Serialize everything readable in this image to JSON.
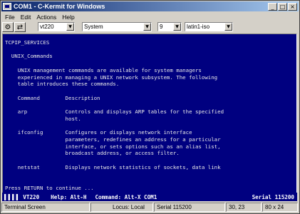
{
  "window": {
    "title": "COM1 - C-Kermit for Windows",
    "controls": {
      "minimize": "_",
      "maximize": "□",
      "close": "×"
    }
  },
  "menu": [
    "File",
    "Edit",
    "Actions",
    "Help"
  ],
  "toolbar": {
    "terminal_type": "vt220",
    "font": "System",
    "font_size": "9",
    "charset": "latin1-iso"
  },
  "terminal": {
    "lines": [
      "TCPIP_SERVICES",
      "",
      "  UNIX_Commands",
      "",
      "    UNIX management commands are available for system managers",
      "    experienced in managing a UNIX network subsystem. The following",
      "    table introduces these commands.",
      "",
      "    Command        Description",
      "",
      "    arp            Controls and displays ARP tables for the specified",
      "                   host.",
      "",
      "    ifconfig       Configures or displays network interface",
      "                   parameters, redefines an address for a particular",
      "                   interface, or sets options such as an alias list,",
      "                   broadcast address, or access filter.",
      "",
      "    netstat        Displays network statistics of sockets, data link",
      "",
      "",
      "Press RETURN to continue ..."
    ]
  },
  "kermit_status": {
    "blocks": "▌▌▌▌",
    "term": "VT220",
    "help": "Help: Alt-H",
    "command": "Command: Alt-X COM1",
    "serial": "Serial 115200"
  },
  "statusbar": {
    "mode": "Terminal Screen",
    "locus": "Locus: Local",
    "serial": "Serial 115200",
    "cursor": "30, 23",
    "size": "80 x 24"
  },
  "colors": {
    "terminal_bg": "#000080",
    "terminal_fg": "#e8e8e8",
    "title_gradient_start": "#0a246a"
  }
}
